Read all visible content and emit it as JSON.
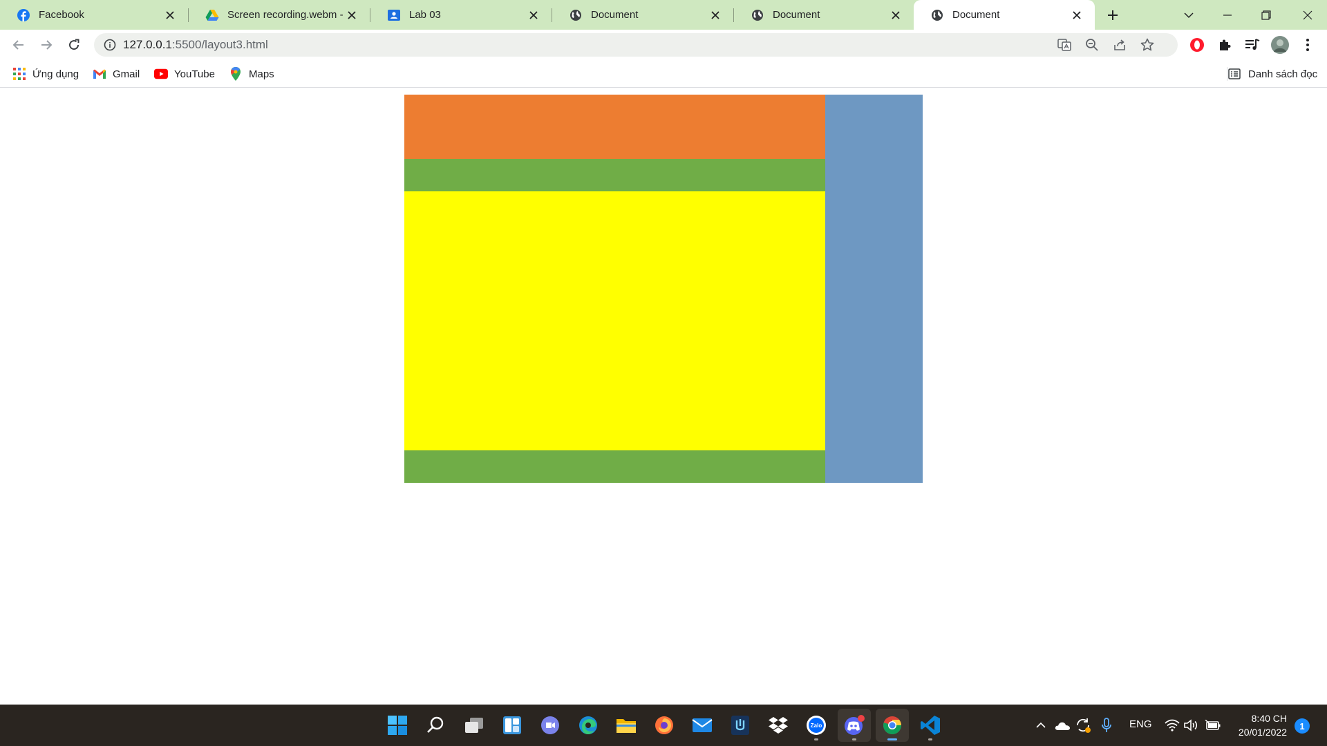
{
  "browser": {
    "tabs": [
      {
        "title": "Facebook",
        "icon": "facebook-icon"
      },
      {
        "title": "Screen recording.webm - Google Drive",
        "icon": "google-drive-icon"
      },
      {
        "title": "Lab 03",
        "icon": "classroom-icon"
      },
      {
        "title": "Document",
        "icon": "globe-icon"
      },
      {
        "title": "Document",
        "icon": "globe-icon"
      },
      {
        "title": "Document",
        "icon": "globe-icon",
        "active": true
      }
    ],
    "address_bar": {
      "host": "127.0.0.1",
      "path": ":5500/layout3.html"
    },
    "bookmarks": [
      {
        "label": "Ứng dụng",
        "icon": "apps-grid-icon"
      },
      {
        "label": "Gmail",
        "icon": "gmail-icon"
      },
      {
        "label": "YouTube",
        "icon": "youtube-icon"
      },
      {
        "label": "Maps",
        "icon": "maps-icon"
      }
    ],
    "reading_list": "Danh sách đọc"
  },
  "page": {
    "blocks": [
      {
        "name": "header",
        "color": "#ed7d31"
      },
      {
        "name": "nav",
        "color": "#70ad47"
      },
      {
        "name": "main",
        "color": "#ffff00"
      },
      {
        "name": "footer",
        "color": "#70ad47"
      },
      {
        "name": "sidebar",
        "color": "#6e98c2"
      }
    ]
  },
  "taskbar": {
    "apps": [
      "start",
      "search",
      "task-view",
      "widgets",
      "teams-chat",
      "edge",
      "file-explorer",
      "firefox",
      "mail",
      "github-desktop",
      "dropbox",
      "zalo",
      "discord",
      "chrome",
      "vscode"
    ],
    "language": "ENG",
    "time": "8:40 CH",
    "date": "20/01/2022",
    "notification_count": "1"
  }
}
